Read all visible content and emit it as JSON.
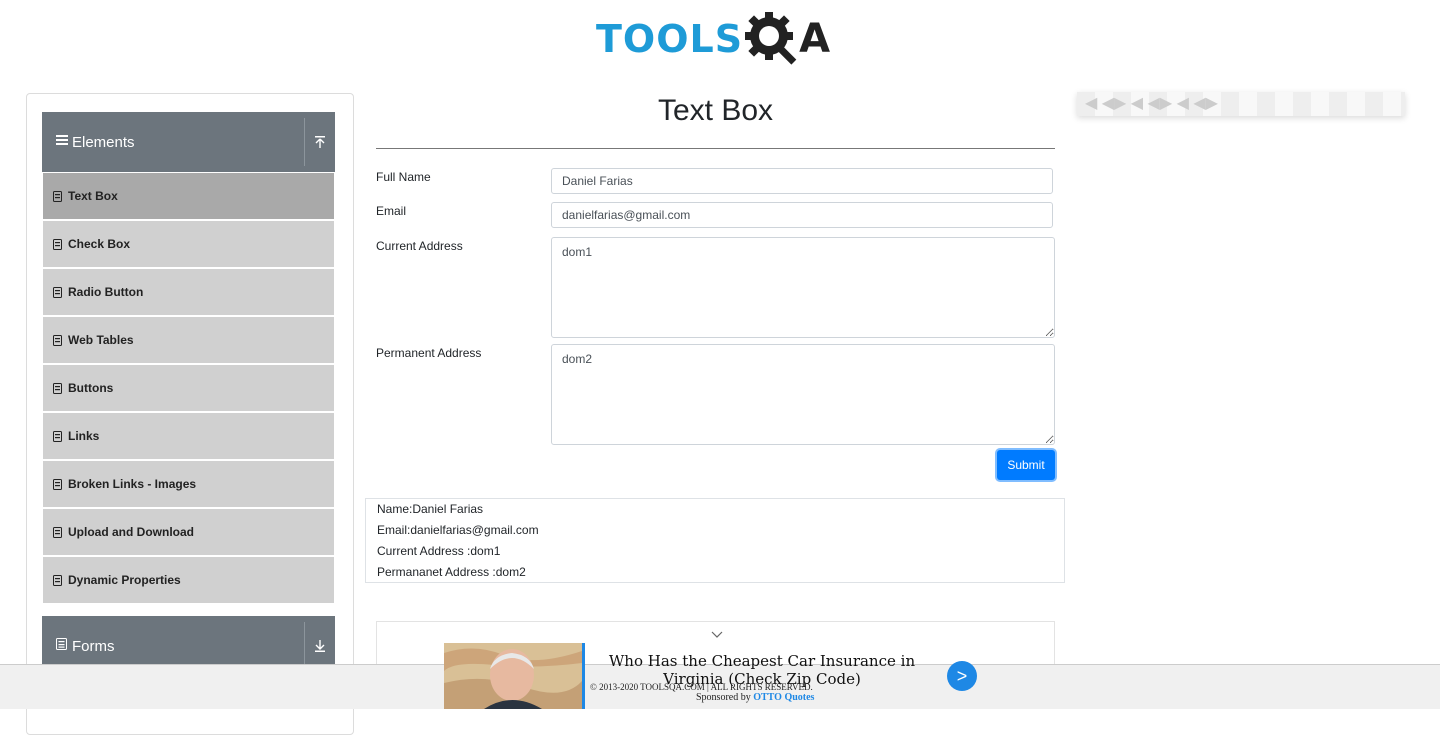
{
  "logo": {
    "text_tools": "TOOLS",
    "text_qa_a": "A"
  },
  "sidebar": {
    "elements_group": {
      "title": "Elements"
    },
    "items": [
      {
        "label": "Text Box"
      },
      {
        "label": "Check Box"
      },
      {
        "label": "Radio Button"
      },
      {
        "label": "Web Tables"
      },
      {
        "label": "Buttons"
      },
      {
        "label": "Links"
      },
      {
        "label": "Broken Links - Images"
      },
      {
        "label": "Upload and Download"
      },
      {
        "label": "Dynamic Properties"
      }
    ],
    "forms_group": {
      "title": "Forms"
    }
  },
  "main": {
    "title": "Text Box",
    "full_name": {
      "label": "Full Name",
      "value": "Daniel Farias"
    },
    "email": {
      "label": "Email",
      "value": "danielfarias@gmail.com"
    },
    "current_address": {
      "label": "Current Address",
      "value": "dom1"
    },
    "permanent_address": {
      "label": "Permanent Address",
      "value": "dom2"
    },
    "submit_label": "Submit"
  },
  "output": {
    "name": "Name:Daniel Farias",
    "email": "Email:danielfarias@gmail.com",
    "current": "Current Address :dom1",
    "permanent": "Permananet Address :dom2"
  },
  "footer": {
    "ad_headline": "Who Has the Cheapest Car Insurance in Virginia (Check Zip Code)",
    "ad_arrow": ">",
    "copyright": "© 2013-2020 TOOLSQA.COM | ALL RIGHTS RESERVED.",
    "sponsored_prefix": "Sponsored by",
    "sponsor_name": "OTTO Quotes"
  },
  "colors": {
    "accent": "#007bff",
    "brand": "#1e9bd7",
    "sidebar_header": "#6c757d"
  }
}
